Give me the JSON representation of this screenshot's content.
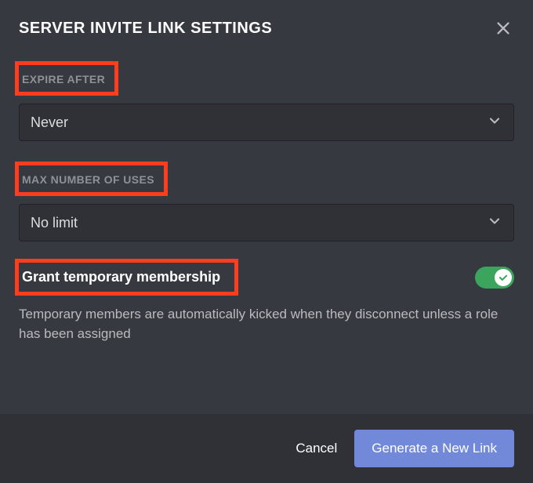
{
  "header": {
    "title": "SERVER INVITE LINK SETTINGS"
  },
  "fields": {
    "expire": {
      "label": "EXPIRE AFTER",
      "value": "Never"
    },
    "maxUses": {
      "label": "MAX NUMBER OF USES",
      "value": "No limit"
    },
    "tempMembership": {
      "label": "Grant temporary membership",
      "description": "Temporary members are automatically kicked when they disconnect unless a role has been assigned",
      "enabled": true
    }
  },
  "footer": {
    "cancel": "Cancel",
    "generate": "Generate a New Link"
  }
}
